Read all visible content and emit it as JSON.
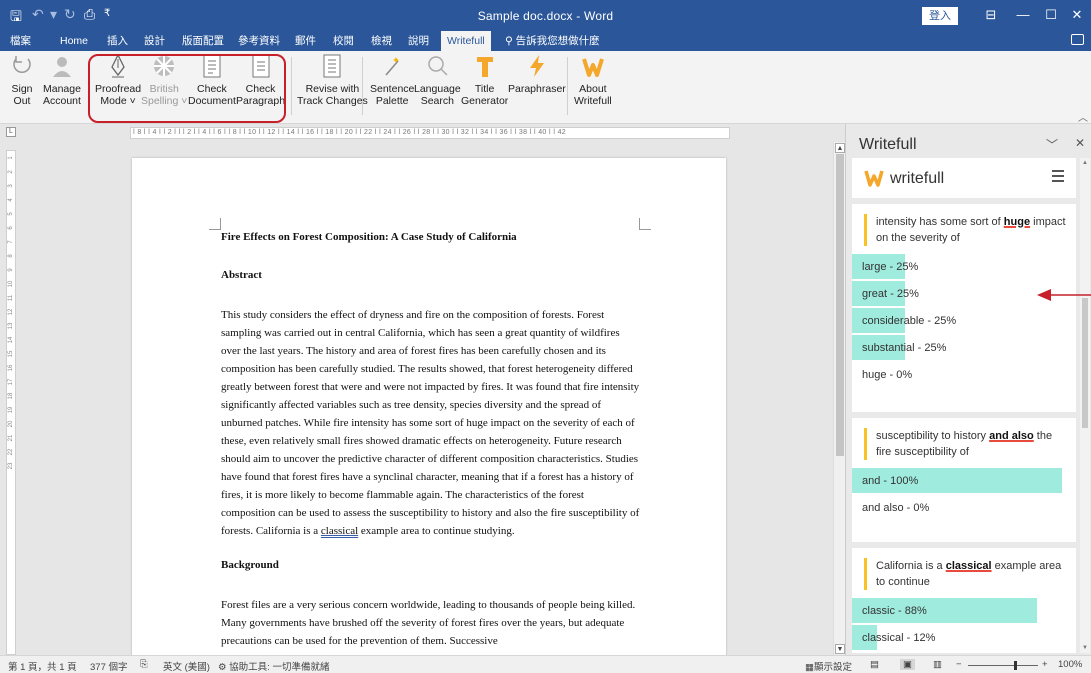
{
  "window": {
    "title": "Sample doc.docx - Word",
    "sign_in": "登入"
  },
  "tabs": [
    {
      "label": "檔案"
    },
    {
      "label": "Home"
    },
    {
      "label": "插入"
    },
    {
      "label": "設計"
    },
    {
      "label": "版面配置"
    },
    {
      "label": "參考資料"
    },
    {
      "label": "郵件"
    },
    {
      "label": "校閱"
    },
    {
      "label": "檢視"
    },
    {
      "label": "說明"
    },
    {
      "label": "Writefull"
    }
  ],
  "tell_me": "告訴我您想做什麼",
  "ribbon": {
    "sign_out": [
      "Sign",
      "Out"
    ],
    "manage": [
      "Manage",
      "Account"
    ],
    "proofread": [
      "Proofread",
      "Mode ˅"
    ],
    "british": [
      "British",
      "Spelling ˅"
    ],
    "check_doc": [
      "Check",
      "Document"
    ],
    "check_par": [
      "Check",
      "Paragraph"
    ],
    "revise": [
      "Revise with",
      "Track Changes"
    ],
    "sentence": [
      "Sentence",
      "Palette"
    ],
    "language": [
      "Language",
      "Search"
    ],
    "title_gen": [
      "Title",
      "Generator"
    ],
    "paraphraser": [
      "Paraphraser",
      ""
    ],
    "about": [
      "About",
      "Writefull"
    ]
  },
  "ruler": {
    "h": "ǀ 8 ǀ ǀ 4 ǀ ǀ 2 ǀ ǀ ǀ 2 ǀ ǀ 4 ǀ ǀ 6 ǀ ǀ 8 ǀ ǀ 10 ǀ ǀ 12 ǀ ǀ 14 ǀ ǀ 16 ǀ ǀ 18 ǀ ǀ 20 ǀ ǀ 22 ǀ ǀ 24 ǀ ǀ 26 ǀ ǀ 28 ǀ ǀ 30 ǀ ǀ 32 ǀ ǀ 34 ǀ ǀ 36 ǀ ǀ 38 ǀ ǀ 40 ǀ ǀ 42"
  },
  "document": {
    "title": "Fire Effects on Forest Composition: A Case Study of California",
    "abstract_heading": "Abstract",
    "abstract_body": "This study considers the effect of dryness and fire on the composition of forests. Forest sampling was carried out in central California, which has seen a great quantity of wildfires over the last years. The history and area of forest fires has been carefully chosen and its composition has been carefully studied. The results showed, that forest heterogeneity differed greatly between forest that were and were not impacted by fires. It was found that fire intensity significantly affected variables such as tree density, species diversity and the spread of unburned patches. While fire intensity has some sort of huge impact on the severity of each of these, even relatively small fires showed dramatic effects on heterogeneity. Future research should aim to uncover the predictive character of different composition characteristics. Studies have found that forest fires have a synclinal character, meaning that if a forest has a history of fires, it is more likely to become flammable again. The characteristics of the forest composition can be used to assess the susceptibility to history and also the fire susceptibility of forests. California is a ",
    "abstract_underlined": "classical",
    "abstract_end": " example area to continue studying.",
    "background_heading": "Background",
    "background_body": "Forest files are a very serious concern worldwide, leading to thousands of people being killed. Many governments have brushed off the severity of forest fires over the years, but adequate precautions can be used for the prevention of them. Successive"
  },
  "pane": {
    "title": "Writefull",
    "logo_text": "writefull",
    "cards": [
      {
        "context_before": "intensity has some sort of ",
        "context_word": "huge",
        "context_after": " impact on the severity of",
        "suggestions": [
          {
            "label": "large - 25%",
            "pct": 25
          },
          {
            "label": "great - 25%",
            "pct": 25
          },
          {
            "label": "considerable - 25%",
            "pct": 25
          },
          {
            "label": "substantial - 25%",
            "pct": 25
          },
          {
            "label": "huge - 0%",
            "pct": 0
          }
        ]
      },
      {
        "context_before": "susceptibility to history ",
        "context_word": "and also",
        "context_after": " the fire susceptibility of",
        "suggestions": [
          {
            "label": "and - 100%",
            "pct": 100
          },
          {
            "label": "and also - 0%",
            "pct": 0
          }
        ]
      },
      {
        "context_before": "California is a ",
        "context_word": "classical",
        "context_after": " example area to continue",
        "suggestions": [
          {
            "label": "classic - 88%",
            "pct": 88
          },
          {
            "label": "classical - 12%",
            "pct": 12
          }
        ]
      }
    ]
  },
  "status": {
    "page": "第 1 頁，共 1 頁",
    "words": "377 個字",
    "lang": "英文 (美國)",
    "access": "協助工具: 一切準備就緒",
    "display": "顯示設定",
    "zoom": "100%"
  },
  "colors": {
    "brand": "#2b579a",
    "accent_bar": "#8ee8d8",
    "highlight": "#f7c325",
    "red_box": "#c8202a"
  }
}
